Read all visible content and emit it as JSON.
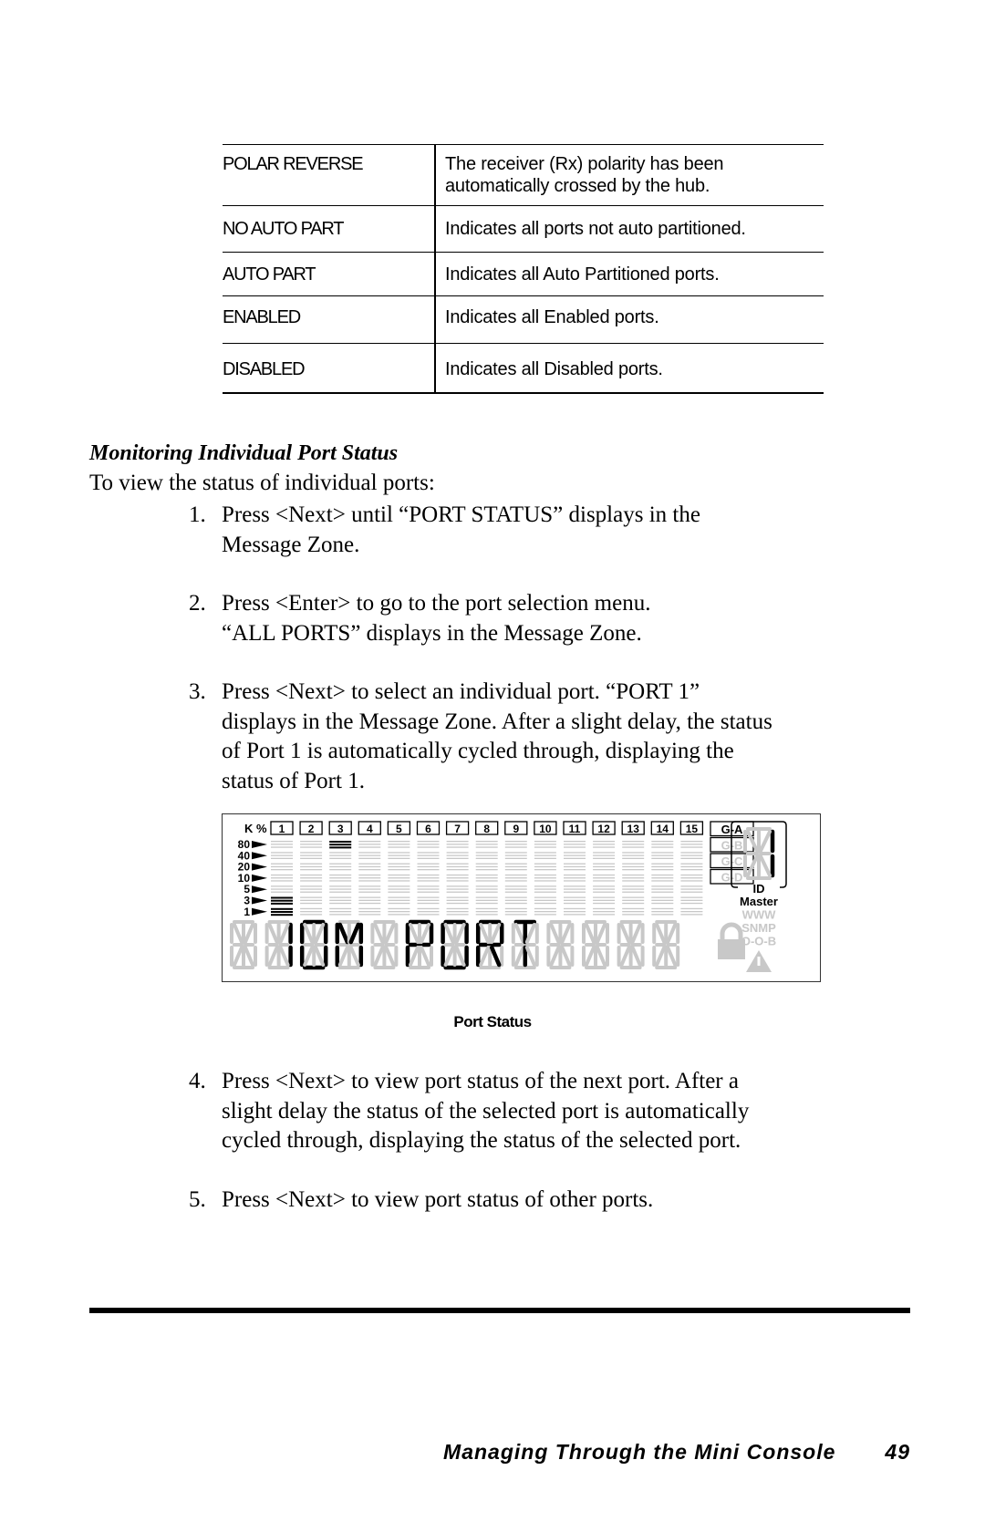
{
  "status_table": {
    "rows": [
      {
        "term": "POLAR REVERSE",
        "description_lines": [
          "The receiver (Rx) polarity has been",
          "automatically crossed by the hub."
        ]
      },
      {
        "term": "NO AUTO PART",
        "description_lines": [
          "Indicates all ports not auto partitioned."
        ]
      },
      {
        "term": "AUTO PART",
        "description_lines": [
          "Indicates all Auto Partitioned ports."
        ]
      },
      {
        "term": "ENABLED",
        "description_lines": [
          "Indicates all Enabled ports."
        ]
      },
      {
        "term": "DISABLED",
        "description_lines": [
          "Indicates all Disabled ports."
        ]
      }
    ]
  },
  "section": {
    "heading": "Monitoring Individual Port Status",
    "intro": "To view the status of individual ports:",
    "steps": [
      {
        "number": "1.",
        "lines": [
          "Press <Next> until “PORT STATUS” displays in the",
          "Message Zone."
        ]
      },
      {
        "number": "2.",
        "lines": [
          "Press <Enter> to go to the port selection menu.",
          "“ALL PORTS” displays in the Message Zone."
        ]
      },
      {
        "number": "3.",
        "lines": [
          "Press <Next> to select an individual port. “PORT 1”",
          "displays in the Message Zone. After a slight delay, the status",
          "of Port 1 is automatically cycled through, displaying the",
          "status of Port 1."
        ]
      },
      {
        "number": "4.",
        "lines": [
          "Press <Next> to view port status of the next port. After a",
          "slight delay the status of the selected port is automatically",
          "cycled through, displaying the status of the selected port."
        ]
      },
      {
        "number": "5.",
        "lines": [
          "Press <Next> to view port status of other ports."
        ]
      }
    ]
  },
  "lcd": {
    "unit_label": "K %",
    "ports": [
      "1",
      "2",
      "3",
      "4",
      "5",
      "6",
      "7",
      "8",
      "9",
      "10",
      "11",
      "12",
      "13",
      "14",
      "15"
    ],
    "levels": [
      "80",
      "40",
      "20",
      "10",
      "5",
      "3",
      "1"
    ],
    "lit_bars": [
      {
        "port": "1",
        "level": "3"
      },
      {
        "port": "1",
        "level": "1"
      },
      {
        "port": "3",
        "level": "80"
      }
    ],
    "groups": [
      {
        "label": "G-A",
        "active": true
      },
      {
        "label": "G-B",
        "active": false
      },
      {
        "label": "G-C",
        "active": false
      },
      {
        "label": "G-D",
        "active": false
      }
    ],
    "id_digit": "1",
    "id_label": "ID",
    "indicators": [
      {
        "label": "Master",
        "active": true
      },
      {
        "label": "WWW",
        "active": false
      },
      {
        "label": "SNMP",
        "active": false
      },
      {
        "label": "O-O-B",
        "active": false
      }
    ],
    "lock_icon": "lock-icon",
    "warning_icon": "warning-icon",
    "message_zone": [
      "",
      "1",
      "0",
      "M",
      "",
      "P",
      "O",
      "R",
      "T",
      "",
      "",
      "",
      ""
    ],
    "colors": {
      "lit": "#000000",
      "unlit": "#c8c8c8",
      "frame": "#333333"
    }
  },
  "figure_caption": "Port Status",
  "footer": {
    "title": "Managing Through the Mini Console",
    "page_number": "49"
  }
}
